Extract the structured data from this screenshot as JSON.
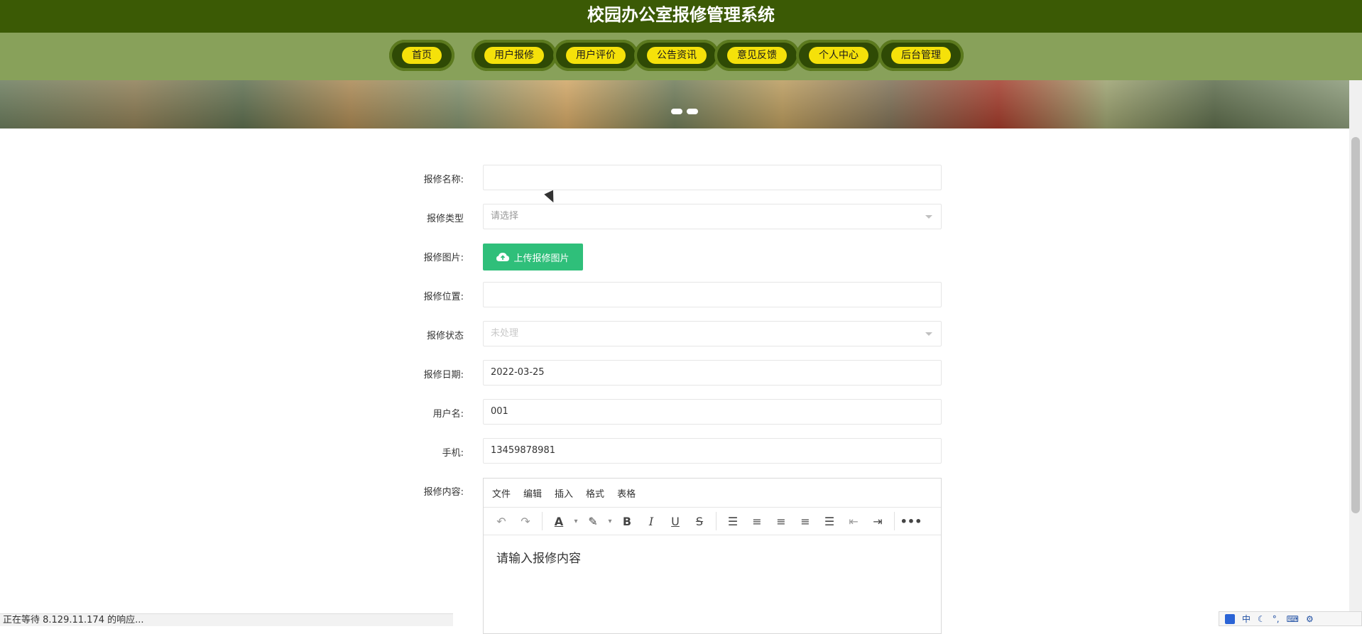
{
  "header": {
    "title": "校园办公室报修管理系统"
  },
  "nav": {
    "items": [
      {
        "label": "首页"
      },
      {
        "label": "用户报修"
      },
      {
        "label": "用户评价"
      },
      {
        "label": "公告资讯"
      },
      {
        "label": "意见反馈"
      },
      {
        "label": "个人中心"
      },
      {
        "label": "后台管理"
      }
    ]
  },
  "form": {
    "name_label": "报修名称:",
    "type_label": "报修类型",
    "type_placeholder": "请选择",
    "image_label": "报修图片:",
    "upload_button": "上传报修图片",
    "location_label": "报修位置:",
    "status_label": "报修状态",
    "status_value": "未处理",
    "date_label": "报修日期:",
    "date_value": "2022-03-25",
    "username_label": "用户名:",
    "username_value": "001",
    "phone_label": "手机:",
    "phone_value": "13459878981",
    "content_label": "报修内容:"
  },
  "editor": {
    "menus": [
      "文件",
      "编辑",
      "插入",
      "格式",
      "表格"
    ],
    "placeholder": "请输入报修内容"
  },
  "statusbar": {
    "text": "正在等待 8.129.11.174 的响应..."
  },
  "ime": {
    "lang": "中"
  }
}
